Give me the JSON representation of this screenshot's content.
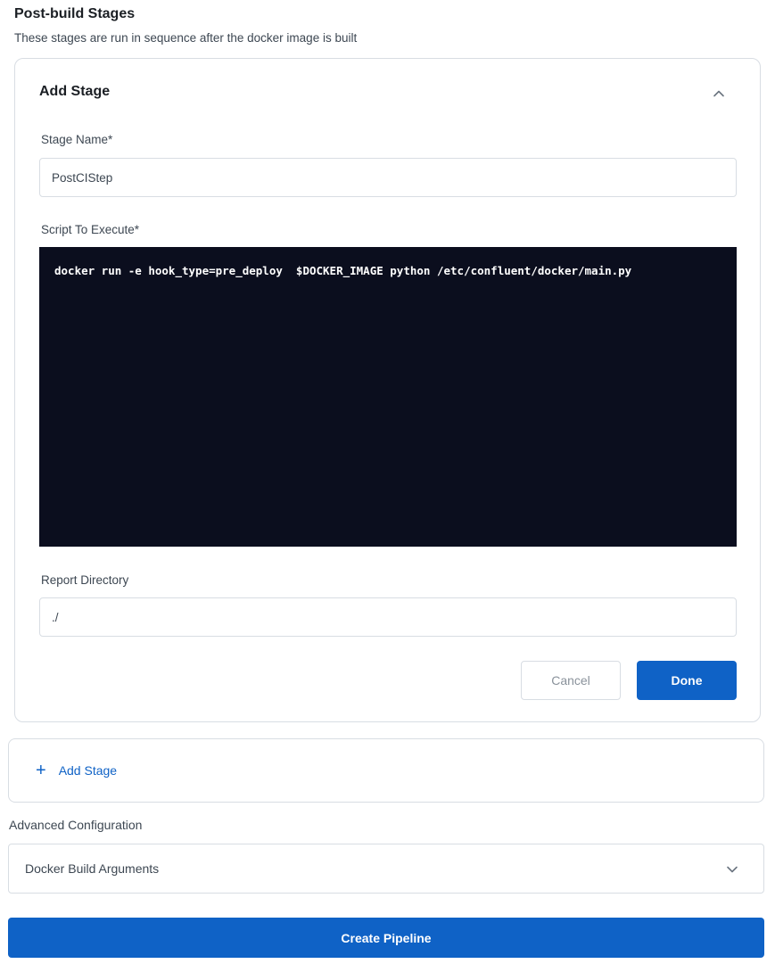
{
  "section": {
    "title": "Post-build Stages",
    "subtitle": "These stages are run in sequence after the docker image is built"
  },
  "stage_form": {
    "title": "Add Stage",
    "collapse_icon": "chevron-up-icon",
    "stage_name": {
      "label": "Stage Name*",
      "value": "PostCIStep"
    },
    "script": {
      "label": "Script To Execute*",
      "value": "docker run -e hook_type=pre_deploy  $DOCKER_IMAGE python /etc/confluent/docker/main.py"
    },
    "report_directory": {
      "label": "Report Directory",
      "value": "./"
    },
    "cancel_label": "Cancel",
    "done_label": "Done"
  },
  "add_stage": {
    "icon": "plus-icon",
    "plus": "+",
    "label": "Add Stage"
  },
  "advanced": {
    "label": "Advanced Configuration",
    "docker_build_args_label": "Docker Build Arguments",
    "expand_icon": "chevron-down-icon"
  },
  "create_pipeline_label": "Create Pipeline",
  "colors": {
    "primary": "#0f62c6",
    "editor_bg": "#0b0e1e",
    "border": "#d8dde3"
  }
}
